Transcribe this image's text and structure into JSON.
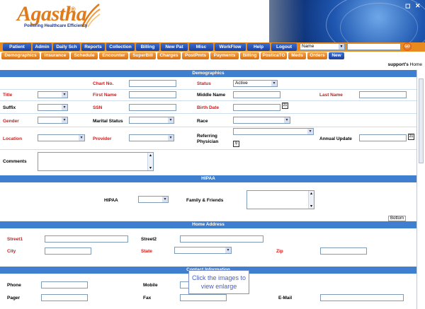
{
  "brand": {
    "name": "Agastha",
    "reg": "®",
    "tagline": "Powering Healthcare Efficiency"
  },
  "window_controls": {
    "restore": "◻",
    "close": "✕"
  },
  "nav_main": [
    "Patient",
    "Admin",
    "Daily Sch",
    "Reports",
    "Collection",
    "Billing",
    "New Pat",
    "Misc",
    "WorkFlow",
    "Help",
    "Logout"
  ],
  "nav_search": {
    "select_value": "Name",
    "input_value": "",
    "go_label": "GO"
  },
  "nav_sub": [
    "Demographics",
    "Insurance",
    "Schedule",
    "Encounter",
    "SuperBill",
    "Charges",
    "PostPmts",
    "Payments",
    "Billing",
    "PosticaTO",
    "Meds",
    "Orders",
    "New"
  ],
  "support": {
    "user": "support's",
    "home": "Home"
  },
  "demographics": {
    "header": "Demographics",
    "chart_no": "Chart No.",
    "status": "Status",
    "status_value": "Active",
    "title": "Title",
    "first_name": "First Name",
    "middle_name": "Middle Name",
    "last_name": "Last Name",
    "suffix": "Suffix",
    "ssn": "SSN",
    "birth_date": "Birth Date",
    "gender": "Gender",
    "marital_status": "Marital Status",
    "race": "Race",
    "location": "Location",
    "provider": "Provider",
    "referring_physician": "Referring Physician",
    "annual_update": "Annual Update",
    "comments": "Comments"
  },
  "hipaa": {
    "header": "HIPAA",
    "hipaa_label": "HIPAA",
    "family_friends": "Family & Friends",
    "bottom": "Bottom"
  },
  "home_address": {
    "header": "Home Address",
    "street1": "Street1",
    "street2": "Street2",
    "city": "City",
    "state": "State",
    "zip": "Zip"
  },
  "contact": {
    "header": "Contact Information",
    "phone": "Phone",
    "mobile": "Mobile",
    "pager": "Pager",
    "fax": "Fax",
    "email": "E-Mail"
  },
  "tooltip": {
    "text": "Click the images to view enlarge"
  },
  "colors": {
    "nav_orange": "#e98a1e",
    "nav_blue": "#1c3f9a",
    "section_blue": "#3f7fd0",
    "required_red": "#cc1b1b"
  }
}
